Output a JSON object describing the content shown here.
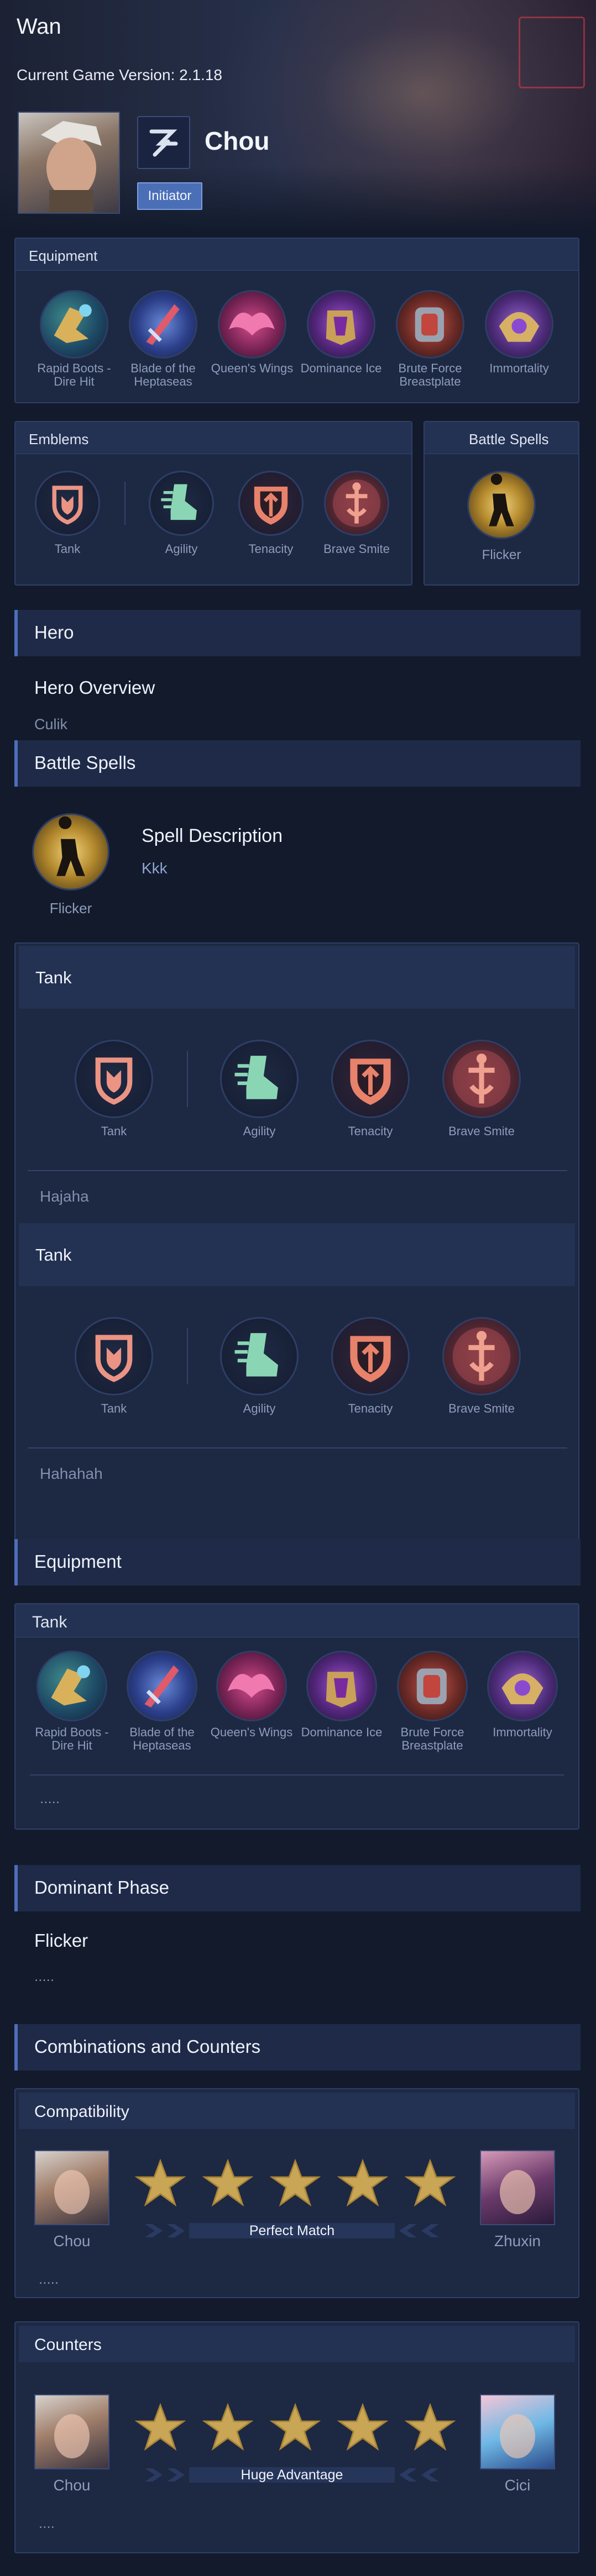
{
  "header": {
    "app_title": "Wan",
    "version_label": "Current Game Version: 2.1.18",
    "hero_name": "Chou",
    "role_badge": "Initiator"
  },
  "top_equipment": {
    "title": "Equipment",
    "items": [
      "Rapid Boots - Dire Hit",
      "Blade of the Heptaseas",
      "Queen's Wings",
      "Dominance Ice",
      "Brute Force Breastplate",
      "Immortality"
    ]
  },
  "top_emblems": {
    "title": "Emblems",
    "main": "Tank",
    "talents": [
      "Agility",
      "Tenacity",
      "Brave Smite"
    ]
  },
  "top_spells": {
    "title": "Battle Spells",
    "spell": "Flicker"
  },
  "hero_section": {
    "title": "Hero",
    "overview_title": "Hero Overview",
    "overview_text": "Culik"
  },
  "spell_section": {
    "title": "Battle Spells",
    "spell": "Flicker",
    "desc_title": "Spell Description",
    "desc_text": "Kkk"
  },
  "emblem_builds": [
    {
      "title": "Tank",
      "main": "Tank",
      "talents": [
        "Agility",
        "Tenacity",
        "Brave Smite"
      ],
      "note": "Hajaha"
    },
    {
      "title": "Tank",
      "main": "Tank",
      "talents": [
        "Agility",
        "Tenacity",
        "Brave Smite"
      ],
      "note": "Hahahah"
    }
  ],
  "equipment_section": {
    "title": "Equipment",
    "build_title": "Tank",
    "items": [
      "Rapid Boots - Dire Hit",
      "Blade of the Heptaseas",
      "Queen's Wings",
      "Dominance Ice",
      "Brute Force Breastplate",
      "Immortality"
    ],
    "note": "....."
  },
  "dominant_phase": {
    "title": "Dominant Phase",
    "subtitle": "Flicker",
    "note": "....."
  },
  "combos": {
    "title": "Combinations and Counters",
    "compatibility": {
      "title": "Compatibility",
      "left_hero": "Chou",
      "right_hero": "Zhuxin",
      "rating_label": "Perfect Match",
      "stars": 5,
      "note": "....."
    },
    "counters": {
      "title": "Counters",
      "left_hero": "Chou",
      "right_hero": "Cici",
      "rating_label": "Huge Advantage",
      "stars": 5,
      "note": "...."
    }
  },
  "colors": {
    "background": "#121a2c",
    "panel": "#1d2843",
    "accent_blue": "#4d6fb8",
    "star_gold": "#c9a655",
    "emblem_orange": "#e8826a",
    "emblem_green": "#8ad6b4"
  }
}
